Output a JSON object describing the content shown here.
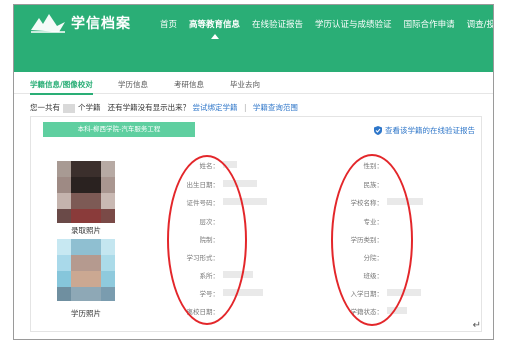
{
  "header": {
    "logo_text": "学信档案",
    "nav": [
      "首页",
      "高等教育信息",
      "在线验证报告",
      "学历认证与成绩验证",
      "国际合作申请",
      "调查/投"
    ],
    "active_nav": 1
  },
  "subtabs": [
    "学籍信息/图像校对",
    "学历信息",
    "考研信息",
    "毕业去向"
  ],
  "infoline": {
    "prefix": "您一共有",
    "count_label": "个学籍",
    "question": "还有学籍没有显示出来？",
    "link_bind": "尝试绑定学籍",
    "separator": "|",
    "link_query": "学籍查询范围"
  },
  "card": {
    "ribbon": "本科-柳西学院-汽车服务工程",
    "verify_link": "查看该学籍的在线验证报告",
    "photo1_caption": "录取照片",
    "photo2_caption": "学历照片",
    "left_fields": [
      "姓名：",
      "出生日期：",
      "证件号码：",
      "层次：",
      "院制：",
      "学习形式：",
      "系所：",
      "学号：",
      "离校日期："
    ],
    "right_fields": [
      "性别：",
      "民族：",
      "学校名称：",
      "专业：",
      "学历类别：",
      "分院：",
      "班级：",
      "入学日期：",
      "学籍状态："
    ]
  },
  "colors": {
    "brand": "#2aae76",
    "link": "#2e76c9",
    "annotation": "#e3262a"
  },
  "return_mark": "↵"
}
